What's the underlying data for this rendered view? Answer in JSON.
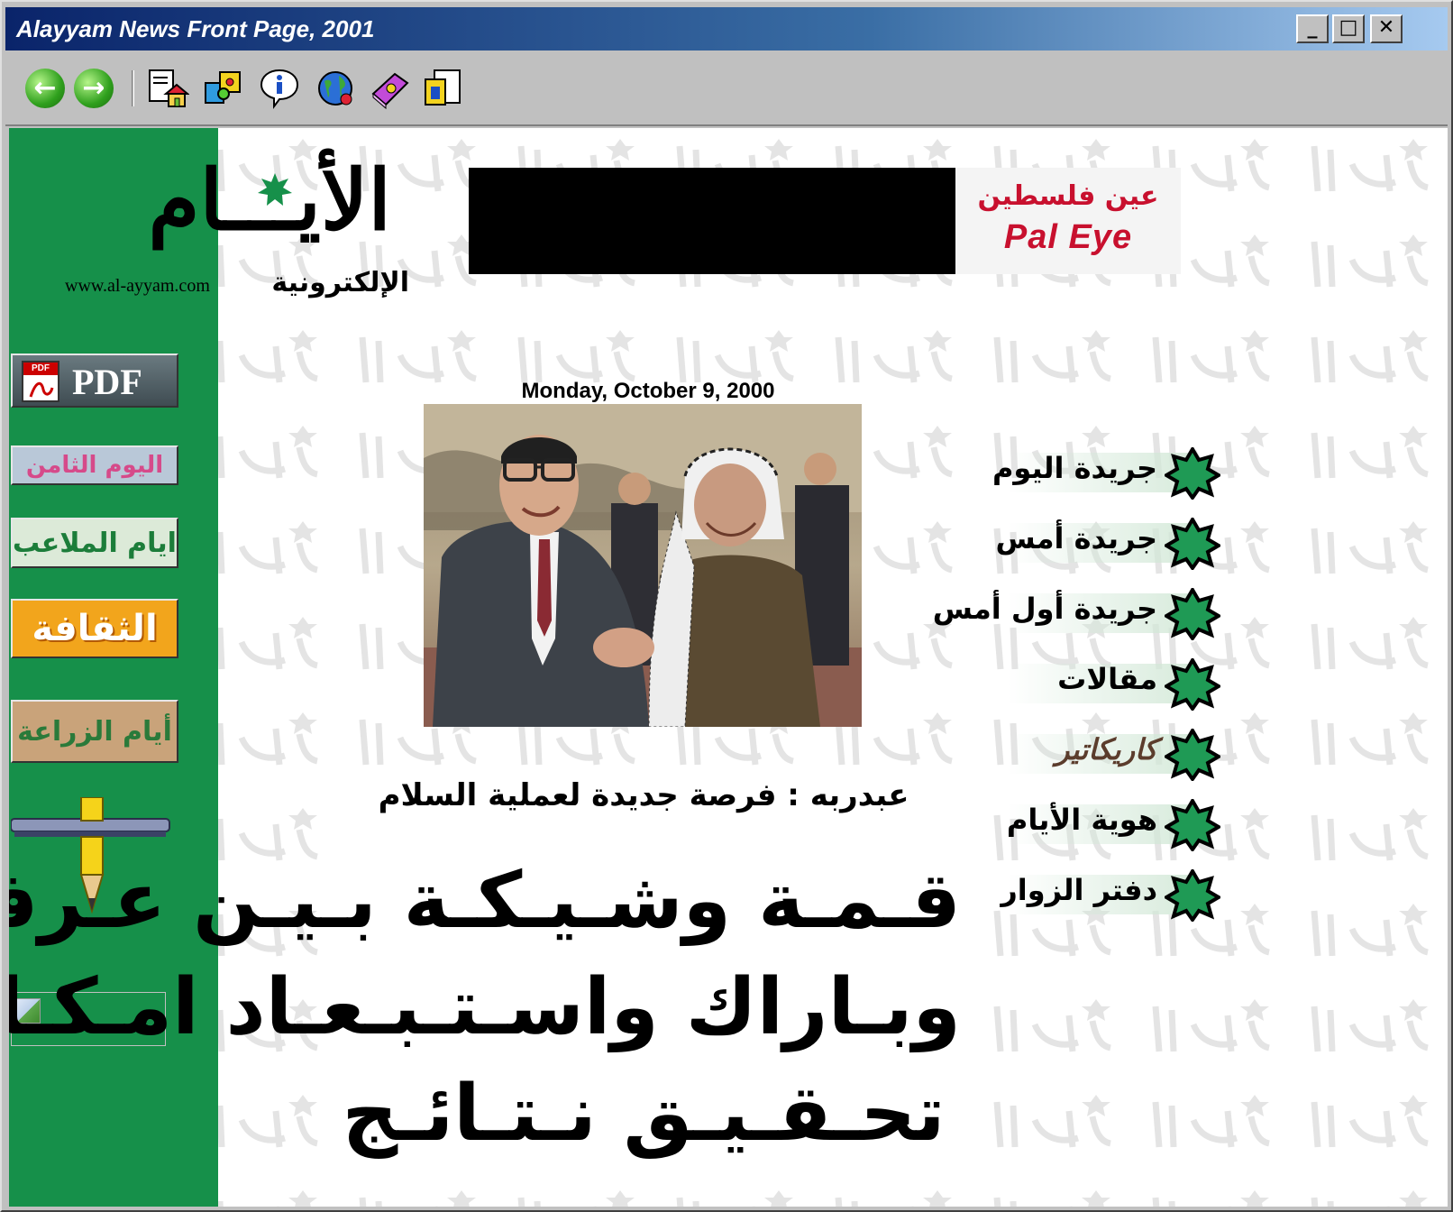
{
  "window": {
    "title": "Alayyam News Front Page, 2001",
    "minimize_label": "_",
    "maximize_label": "□",
    "close_label": "✕"
  },
  "toolbar": {
    "back_icon": "back-arrow-icon",
    "forward_icon": "forward-arrow-icon",
    "tools": [
      "home-page-icon",
      "puzzle-icon",
      "info-icon",
      "globe-icon",
      "book-icon",
      "document-icon"
    ]
  },
  "colors": {
    "sidebar_green": "#16904a",
    "title_blue": "#0a246a",
    "paleye_red": "#c8102e"
  },
  "site": {
    "logo_text": "الأيـــام",
    "logo_subtitle": "الإلكترونية",
    "logo_url": "www.al-ayyam.com"
  },
  "sidebar": {
    "pdf_label": "PDF",
    "banners": [
      {
        "label": "اليوم الثامن",
        "bg": "#b9c8d8",
        "fg": "#d64a8a"
      },
      {
        "label": "ايام الملاعب",
        "bg": "#dcead8",
        "fg": "#1c7d3a"
      },
      {
        "label": "الثقافة",
        "bg": "#f2a51c",
        "fg": "#ffffff"
      },
      {
        "label": "أيام الزراعة",
        "bg": "#c9a37a",
        "fg": "#2a7a3a"
      }
    ]
  },
  "ad": {
    "paleye_arabic": "عين فلسطين",
    "paleye_english": "Pal Eye"
  },
  "main": {
    "date": "Monday, October 9, 2000",
    "subheadline": "عبدربه : فرصة جديدة لعملية السلام",
    "headline_lines": [
      "قـمـة وشـيـكـة بـيـن عـرفـات",
      "وبـاراك واسـتـبـعـاد امـكـانـيـة",
      "تحـقـيـق نـتـائـج"
    ]
  },
  "menu": {
    "items": [
      {
        "label": "جريدة اليوم"
      },
      {
        "label": "جريدة أمس"
      },
      {
        "label": "جريدة أول أمس"
      },
      {
        "label": "مقالات"
      },
      {
        "label": "كاريكاتير"
      },
      {
        "label": "هوية الأيام"
      },
      {
        "label": "دفتر الزوار"
      }
    ]
  }
}
